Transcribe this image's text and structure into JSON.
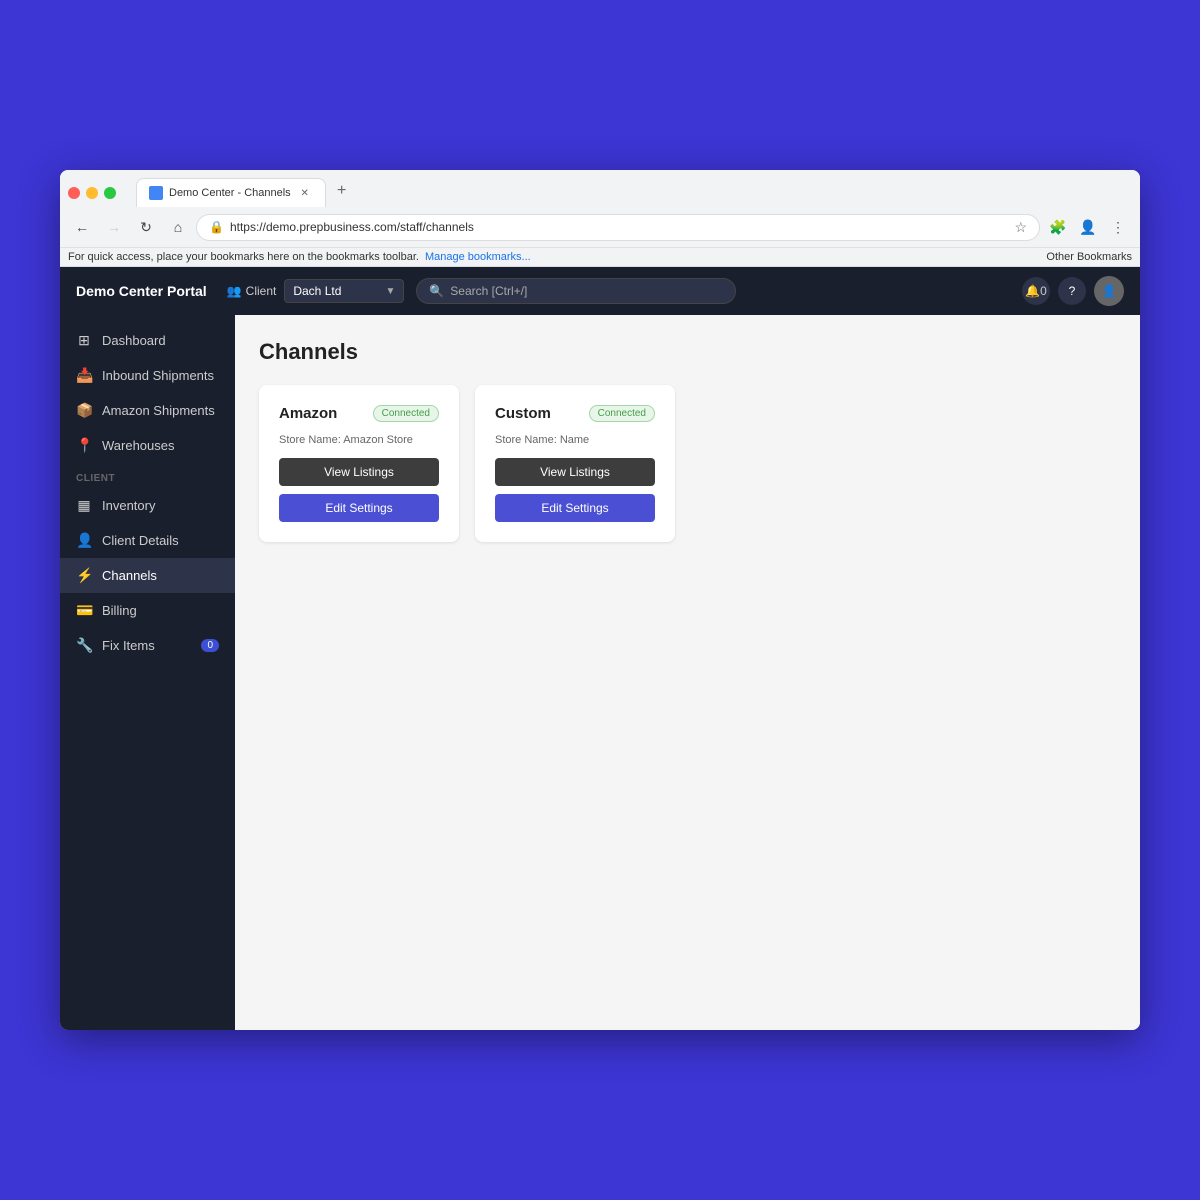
{
  "browser": {
    "tab_title": "Demo Center - Channels",
    "url": "https://demo.prepbusiness.com/staff/channels",
    "bookmark_bar_text": "For quick access, place your bookmarks here on the bookmarks toolbar.",
    "bookmark_link": "Manage bookmarks...",
    "bookmark_other": "Other Bookmarks"
  },
  "app": {
    "logo": "Demo Center Portal",
    "client_label": "Client",
    "client_value": "Dach Ltd",
    "search_placeholder": "Search [Ctrl+/]"
  },
  "sidebar": {
    "items": [
      {
        "label": "Dashboard",
        "icon": "⊞",
        "active": false
      },
      {
        "label": "Inbound Shipments",
        "icon": "📥",
        "active": false
      },
      {
        "label": "Amazon Shipments",
        "icon": "📦",
        "active": false
      },
      {
        "label": "Warehouses",
        "icon": "📍",
        "active": false
      }
    ],
    "client_section_label": "CLIENT",
    "client_items": [
      {
        "label": "Inventory",
        "icon": "▦",
        "active": false
      },
      {
        "label": "Client Details",
        "icon": "👤",
        "active": false
      },
      {
        "label": "Channels",
        "icon": "⚡",
        "active": true
      },
      {
        "label": "Billing",
        "icon": "💳",
        "active": false
      },
      {
        "label": "Fix Items",
        "icon": "🔧",
        "active": false,
        "badge": "0"
      }
    ]
  },
  "page": {
    "title": "Channels"
  },
  "channels": [
    {
      "name": "Amazon",
      "status": "Connected",
      "store_label": "Store Name:",
      "store_name": "Amazon Store",
      "btn_view": "View Listings",
      "btn_edit": "Edit Settings"
    },
    {
      "name": "Custom",
      "status": "Connected",
      "store_label": "Store Name:",
      "store_name": "Name",
      "btn_view": "View Listings",
      "btn_edit": "Edit Settings"
    }
  ],
  "notifications": {
    "bell_count": "0"
  }
}
